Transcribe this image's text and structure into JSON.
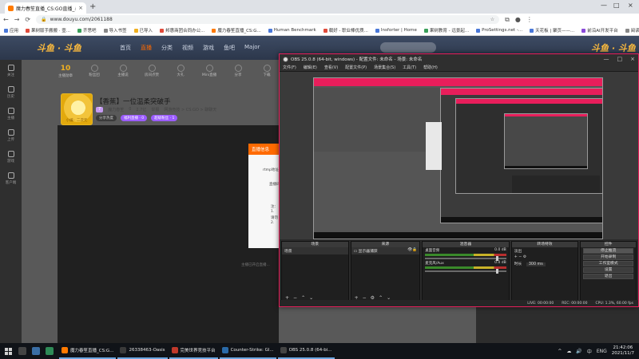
{
  "browser": {
    "tab_title": "魔力春笙直播_CS:GO直播_斗鱼",
    "tab_close": "×",
    "new_tab": "+",
    "window_controls": [
      "—",
      "□",
      "×"
    ],
    "nav": [
      "←",
      "→",
      "⟳"
    ],
    "url": "www.douyu.com/2061188",
    "bookmarks": [
      {
        "label": "应用",
        "color": "#4a78d8"
      },
      {
        "label": "果树版手搬搬 · 壹...",
        "color": "#e04b3a"
      },
      {
        "label": "齐思吧",
        "color": "#3aa05a"
      },
      {
        "label": "导入书签",
        "color": "#888888"
      },
      {
        "label": "已导入",
        "color": "#f0b020"
      },
      {
        "label": "邦惠商团合同办公...",
        "color": "#e04b3a"
      },
      {
        "label": "魔力春笙直播_CS:G...",
        "color": "#ff7a00"
      },
      {
        "label": "Human Benchmark",
        "color": "#4a78d8"
      },
      {
        "label": "载好 - 职业棒优质...",
        "color": "#e04b3a"
      },
      {
        "label": "Insforter | Home",
        "color": "#4a78d8"
      },
      {
        "label": "果树教育 - 远景起...",
        "color": "#3aa05a"
      },
      {
        "label": "ProSettings.net -...",
        "color": "#4a78d8"
      },
      {
        "label": "天花板 | 聚页——...",
        "color": "#4a78d8"
      },
      {
        "label": "前沿AI开发平台",
        "color": "#8a4ad8"
      },
      {
        "label": "阅读列表",
        "color": "#888888"
      }
    ],
    "bookmark_right": "抖音"
  },
  "douyu": {
    "logo": "斗鱼 · 斗鱼",
    "nav": [
      "首页",
      "直播",
      "分类",
      "视频",
      "游戏",
      "鱼吧",
      "Major"
    ],
    "active_nav": "直播",
    "logo_right": "斗鱼 · 斗鱼",
    "side_items": [
      "关注",
      "历史",
      "主播",
      "上传",
      "游戏",
      "客户端"
    ],
    "tools": [
      {
        "num": "10",
        "label": "主播勋章"
      },
      {
        "num": "",
        "label": "粉丝团"
      },
      {
        "num": "",
        "label": "主播说"
      },
      {
        "num": "",
        "label": "房间点赞"
      },
      {
        "num": "",
        "label": "大礼"
      },
      {
        "num": "",
        "label": "Mini直播"
      },
      {
        "num": "",
        "label": "分享"
      },
      {
        "num": "",
        "label": "下载"
      }
    ],
    "avatar_label": "小编 · 二次元",
    "room_title": "【香蕉】一位温柔突破手",
    "room_meta": [
      "举报",
      "网游竞技 > CS:GO > 聊聊天"
    ],
    "room_level": "7",
    "room_sub": [
      "魔力春笙",
      "0",
      "2.7亿"
    ],
    "room_tags": [
      {
        "label": "分享热度",
        "style": "g"
      },
      {
        "label": "福利直播 · 0",
        "style": "p"
      },
      {
        "label": "超级粉丝 · 1",
        "style": "p"
      }
    ],
    "dialog_title": "直播信息",
    "dialog_lines": [
      "rtmp地址",
      "直播码",
      "注：",
      "1.",
      "请勿",
      "2."
    ],
    "page_note": "主播已开启直播..."
  },
  "obs": {
    "title": "OBS 25.0.8 (64-bit, windows) - 配置文件: 未命名 - 场景: 未命名",
    "menu": [
      "文件(F)",
      "编辑(E)",
      "查看(V)",
      "配置文件(P)",
      "场景集合(S)",
      "工具(T)",
      "帮助(H)"
    ],
    "win_controls": [
      "—",
      "□",
      "×"
    ],
    "docks": {
      "scenes": {
        "title": "场景",
        "items": [
          "场景"
        ]
      },
      "sources": {
        "title": "来源",
        "items": [
          "显示器捕获"
        ]
      },
      "mixer": {
        "title": "混音器",
        "channels": [
          {
            "name": "桌面音频",
            "db": "0.0 dB"
          },
          {
            "name": "麦克风/Aux",
            "db": "0.0 dB"
          }
        ]
      },
      "transitions": {
        "title": "转场特效",
        "type": "淡出",
        "duration_label": "时长",
        "duration": "300 ms"
      },
      "controls": {
        "title": "控件",
        "buttons": [
          "停止推流",
          "开始录制",
          "工作室模式",
          "设置",
          "退出"
        ]
      }
    },
    "dock_tools": [
      "+",
      "−",
      "⚙",
      "⌃",
      "⌄"
    ],
    "status": [
      "LIVE: 00:00:00",
      "REC: 00:00:00",
      "CPU: 1.3%, 60.00 fps"
    ]
  },
  "taskbar": {
    "apps": [
      {
        "label": "魔力春笙直播_CS:G...",
        "color": "#ff7a00"
      },
      {
        "label": "26338463-Oasis",
        "color": "#3a3a3a"
      },
      {
        "label": "完美世界竞技平台",
        "color": "#c0392b"
      },
      {
        "label": "Counter-Strike: Gl...",
        "color": "#2a6aa8"
      },
      {
        "label": "OBS 25.0.8 (64-bi...",
        "color": "#444444"
      }
    ],
    "tray_icons": [
      "^",
      "☁",
      "🔊",
      "中",
      "ENG"
    ],
    "time": "21:42:06",
    "date": "2021/11/7"
  }
}
